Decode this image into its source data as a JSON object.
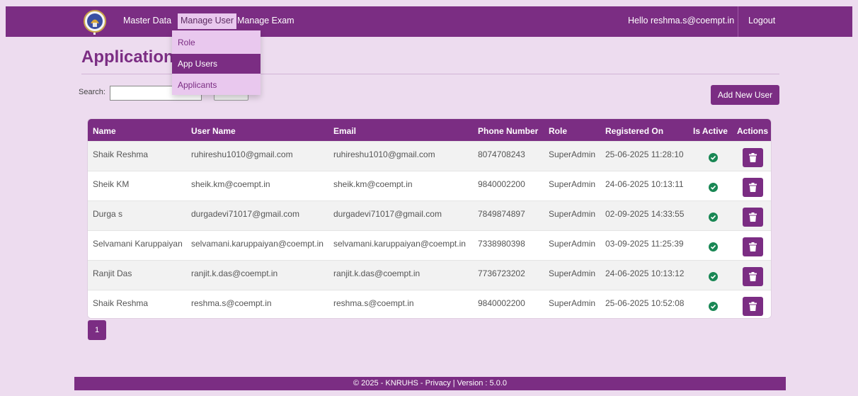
{
  "nav": {
    "items": [
      "Master Data",
      "Manage User",
      "Manage Exam"
    ],
    "greeting": "Hello reshma.s@coempt.in",
    "logout": "Logout"
  },
  "dropdown": {
    "items": [
      "Role",
      "App Users",
      "Applicants"
    ],
    "selected": "App Users"
  },
  "page": {
    "title": "Application"
  },
  "search": {
    "label": "Search:",
    "value": "",
    "button_label": ""
  },
  "add_button": "Add New User",
  "table": {
    "headers": [
      "Name",
      "User Name",
      "Email",
      "Phone Number",
      "Role",
      "Registered On",
      "Is Active",
      "Actions"
    ],
    "rows": [
      {
        "name": "Shaik Reshma",
        "username": "ruhireshu1010@gmail.com",
        "email": "ruhireshu1010@gmail.com",
        "phone": "8074708243",
        "role": "SuperAdmin",
        "registered": "25-06-2025 11:28:10",
        "active": true
      },
      {
        "name": "Sheik KM",
        "username": "sheik.km@coempt.in",
        "email": "sheik.km@coempt.in",
        "phone": "9840002200",
        "role": "SuperAdmin",
        "registered": "24-06-2025 10:13:11",
        "active": true
      },
      {
        "name": "Durga s",
        "username": "durgadevi71017@gmail.com",
        "email": "durgadevi71017@gmail.com",
        "phone": "7849874897",
        "role": "SuperAdmin",
        "registered": "02-09-2025 14:33:55",
        "active": true
      },
      {
        "name": "Selvamani Karuppaiyan",
        "username": "selvamani.karuppaiyan@coempt.in",
        "email": "selvamani.karuppaiyan@coempt.in",
        "phone": "7338980398",
        "role": "SuperAdmin",
        "registered": "03-09-2025 11:25:39",
        "active": true
      },
      {
        "name": "Ranjit Das",
        "username": "ranjit.k.das@coempt.in",
        "email": "ranjit.k.das@coempt.in",
        "phone": "7736723202",
        "role": "SuperAdmin",
        "registered": "24-06-2025 10:13:12",
        "active": true
      },
      {
        "name": "Shaik Reshma",
        "username": "reshma.s@coempt.in",
        "email": "reshma.s@coempt.in",
        "phone": "9840002200",
        "role": "SuperAdmin",
        "registered": "25-06-2025 10:52:08",
        "active": true
      }
    ]
  },
  "pagination": {
    "current": "1"
  },
  "footer": "© 2025 - KNRUHS - Privacy | Version : 5.0.0",
  "colors": {
    "primary": "#7b2d83",
    "background": "#eddcef",
    "active_icon": "#198754"
  },
  "icons": {
    "logo": "university-seal-icon",
    "active": "check-circle-icon",
    "delete": "trash-icon"
  }
}
